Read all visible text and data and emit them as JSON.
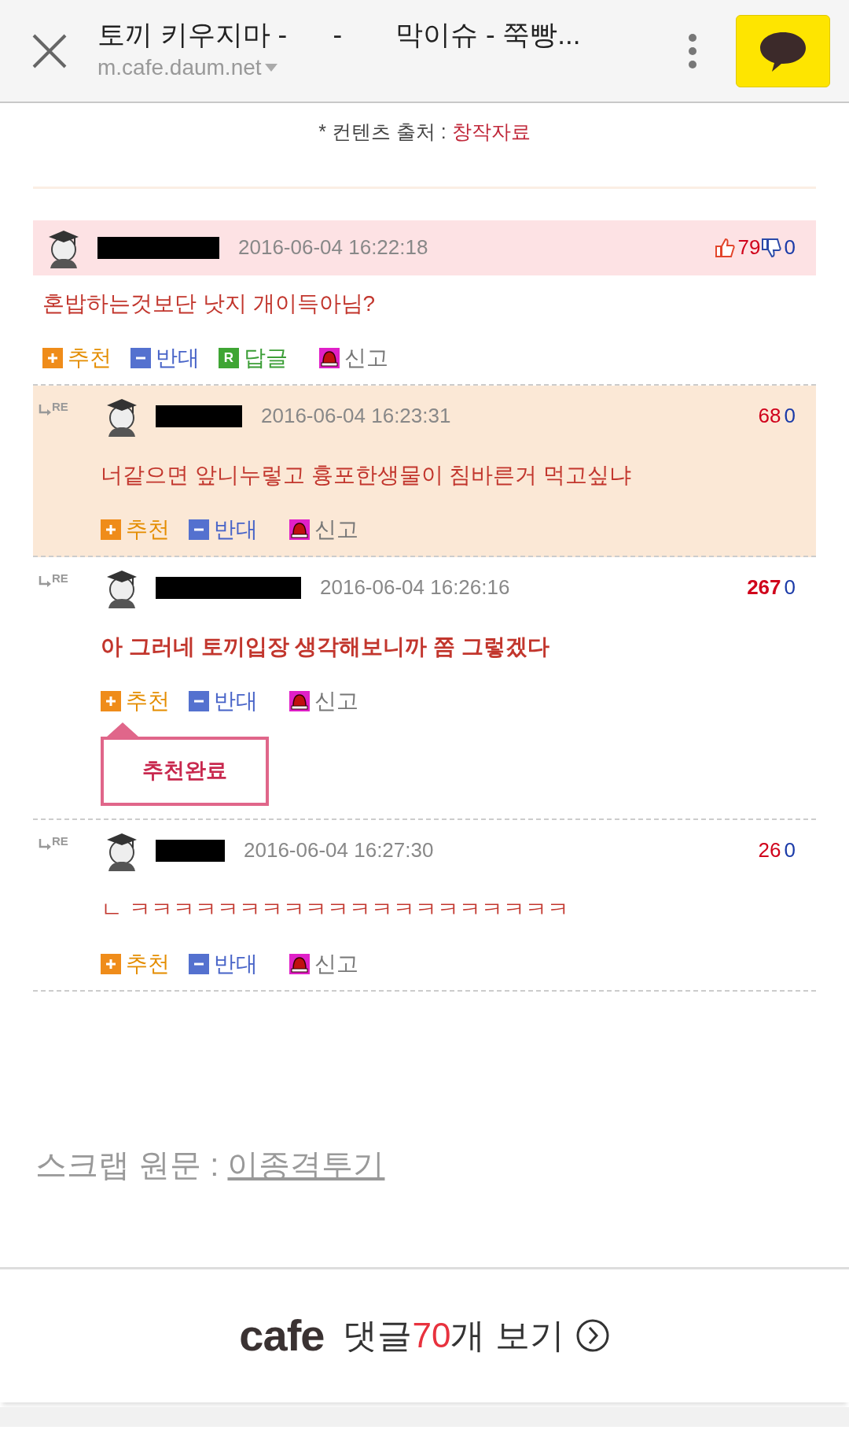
{
  "browser_bar": {
    "title": "토끼 키우지마 -      -       막이슈 - 쭉빵...",
    "url": "m.cafe.daum.net"
  },
  "source_note": {
    "label": "* 컨텐츠 출처 : ",
    "value": "창작자료"
  },
  "comments": [
    {
      "kind": "comment",
      "highlighted": false,
      "bold": false,
      "date": "2016-06-04 16:22:18",
      "likes": "79",
      "dislikes": "0",
      "text": "혼밥하는것보단 낫지 개이득아님?",
      "actions": [
        {
          "kind": "recommend",
          "label": "추천"
        },
        {
          "kind": "oppose",
          "label": "반대"
        },
        {
          "kind": "reply",
          "badge": "R",
          "label": "답글"
        },
        {
          "kind": "report",
          "label": "신고"
        }
      ]
    },
    {
      "kind": "reply",
      "re_mark": "RE",
      "highlighted": true,
      "bold": false,
      "date": "2016-06-04 16:23:31",
      "likes": "68",
      "dislikes": "0",
      "text": "너같으면 앞니누렇고 흉포한생물이 침바른거 먹고싶냐",
      "actions": [
        {
          "kind": "recommend",
          "label": "추천"
        },
        {
          "kind": "oppose",
          "label": "반대"
        },
        {
          "kind": "report",
          "label": "신고"
        }
      ]
    },
    {
      "kind": "reply",
      "re_mark": "RE",
      "highlighted": false,
      "bold": true,
      "date": "2016-06-04 16:26:16",
      "likes": "267",
      "dislikes": "0",
      "text": "아 그러네 토끼입장 생각해보니까 쫌 그렇겠다",
      "actions": [
        {
          "kind": "recommend",
          "label": "추천"
        },
        {
          "kind": "oppose",
          "label": "반대"
        },
        {
          "kind": "report",
          "label": "신고"
        }
      ],
      "popup": "추천완료"
    },
    {
      "kind": "reply",
      "re_mark": "RE",
      "highlighted": false,
      "bold": false,
      "date": "2016-06-04 16:27:30",
      "likes": "26",
      "dislikes": "0",
      "text": "ㄴ ㅋㅋㅋㅋㅋㅋㅋㅋㅋㅋㅋㅋㅋㅋㅋㅋㅋㅋㅋㅋ",
      "actions": [
        {
          "kind": "recommend",
          "label": "추천"
        },
        {
          "kind": "oppose",
          "label": "반대"
        },
        {
          "kind": "report",
          "label": "신고"
        }
      ]
    }
  ],
  "scrap": {
    "label": "스크랩 원문 : ",
    "link": "이종격투기"
  },
  "footer": {
    "logo": "cafe",
    "prefix": "댓글 ",
    "count": "70",
    "suffix": "개 보기"
  }
}
